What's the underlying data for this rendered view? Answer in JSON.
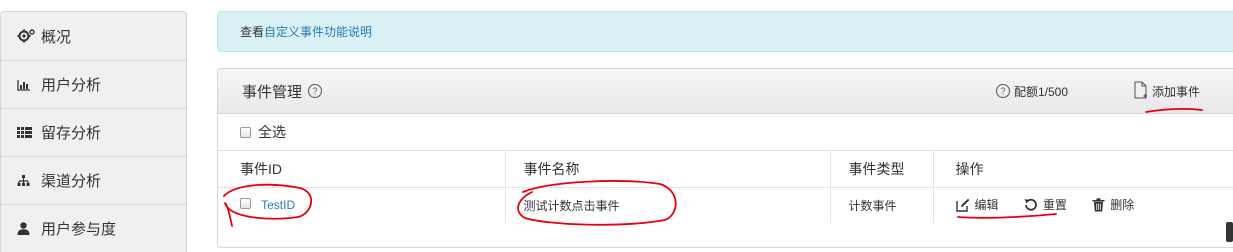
{
  "sidebar": {
    "items": [
      {
        "label": "概况",
        "icon": "gear-icon"
      },
      {
        "label": "用户分析",
        "icon": "bar-chart-icon"
      },
      {
        "label": "留存分析",
        "icon": "grid-icon"
      },
      {
        "label": "渠道分析",
        "icon": "sitemap-icon"
      },
      {
        "label": "用户参与度",
        "icon": "user-icon"
      }
    ]
  },
  "banner": {
    "prefix": "查看",
    "link": "自定义事件功能说明"
  },
  "panel": {
    "title": "事件管理",
    "help": "?",
    "quota": "配额1/500",
    "add_event": "添加事件",
    "select_all": "全选"
  },
  "table": {
    "headers": [
      "事件ID",
      "事件名称",
      "事件类型",
      "操作"
    ],
    "rows": [
      {
        "id": "TestID",
        "name": "测试计数点击事件",
        "type": "计数事件"
      }
    ],
    "actions": {
      "edit": "编辑",
      "reset": "重置",
      "delete": "删除"
    }
  },
  "colors": {
    "link": "#2a7ab7",
    "banner_bg": "#d9f1f5",
    "annotation_red": "#e60012"
  }
}
